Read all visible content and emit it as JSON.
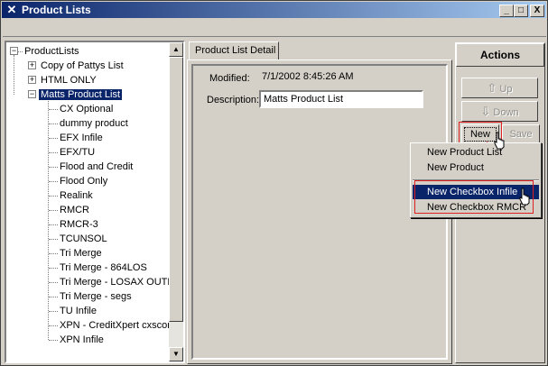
{
  "window": {
    "title": "Product Lists",
    "controls": {
      "minimize": "_",
      "maximize": "□",
      "close": "X"
    }
  },
  "tree": {
    "root": "ProductLists",
    "groups": [
      {
        "label": "Copy of Pattys List",
        "expander": "+"
      },
      {
        "label": "HTML ONLY",
        "expander": "+"
      },
      {
        "label": "Matts Product List",
        "expander": "−",
        "selected": true
      }
    ],
    "children": [
      "CX Optional",
      "dummy product",
      "EFX Infile",
      "EFX/TU",
      "Flood and Credit",
      "Flood Only",
      "Realink",
      "RMCR",
      "RMCR-3",
      "TCUNSOL",
      "Tri Merge",
      "Tri Merge - 864LOS",
      "Tri Merge - LOSAX OUTF",
      "Tri Merge - segs",
      "TU Infile",
      "XPN - CreditXpert cxscore",
      "XPN Infile"
    ]
  },
  "detail": {
    "tab_label": "Product List Detail",
    "modified_label": "Modified:",
    "modified_value": "7/1/2002 8:45:26 AM",
    "description_label": "Description:",
    "description_value": "Matts Product List"
  },
  "actions": {
    "header": "Actions",
    "up_label": "Up",
    "down_label": "Down",
    "new_label": "New",
    "save_label": "Save"
  },
  "context_menu": {
    "items": [
      "New Product List",
      "New Product",
      "New Checkbox Infile",
      "New Checkbox RMCR"
    ],
    "highlighted_index": 2
  }
}
